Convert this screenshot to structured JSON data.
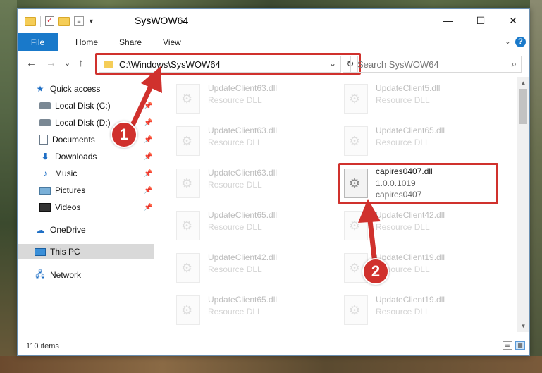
{
  "window": {
    "title": "SysWOW64",
    "controls": {
      "minimize": "—",
      "maximize": "☐",
      "close": "✕"
    }
  },
  "ribbon": {
    "tabs": [
      "File",
      "Home",
      "Share",
      "View"
    ],
    "expand_icon": "chevron-down",
    "help_label": "?"
  },
  "navigation": {
    "back_icon": "←",
    "forward_icon": "→",
    "recent_icon": "⌄",
    "up_icon": "↑",
    "address_path": "C:\\Windows\\SysWOW64",
    "search_placeholder": "Search SysWOW64"
  },
  "sidebar": {
    "items": [
      {
        "label": "Quick access",
        "icon": "star-icon",
        "pinned": false
      },
      {
        "label": "Local Disk (C:)",
        "icon": "drive-icon",
        "pinned": true
      },
      {
        "label": "Local Disk (D:)",
        "icon": "drive-icon",
        "pinned": true
      },
      {
        "label": "Documents",
        "icon": "documents-icon",
        "pinned": true
      },
      {
        "label": "Downloads",
        "icon": "download-icon",
        "pinned": true
      },
      {
        "label": "Music",
        "icon": "music-icon",
        "pinned": true
      },
      {
        "label": "Pictures",
        "icon": "pictures-icon",
        "pinned": true
      },
      {
        "label": "Videos",
        "icon": "videos-icon",
        "pinned": true
      },
      {
        "label": "OneDrive",
        "icon": "cloud-icon",
        "pinned": false
      },
      {
        "label": "This PC",
        "icon": "computer-icon",
        "pinned": false,
        "selected": true
      },
      {
        "label": "Network",
        "icon": "network-icon",
        "pinned": false
      }
    ]
  },
  "files": [
    {
      "name": "UpdateClient63.dll",
      "sub": "Resource DLL",
      "faded": true
    },
    {
      "name": "UpdateClient5.dll",
      "sub": "Resource DLL",
      "faded": true
    },
    {
      "name": "UpdateClient63.dll",
      "sub": "Resource DLL",
      "faded": true
    },
    {
      "name": "UpdateClient65.dll",
      "sub": "Resource DLL",
      "faded": true
    },
    {
      "name": "UpdateClient63.dll",
      "sub": "Resource DLL",
      "faded": true
    },
    {
      "name": "capires0407.dll",
      "sub": "1.0.0.1019",
      "sub2": "capires0407",
      "faded": false,
      "highlighted": true
    },
    {
      "name": "UpdateClient65.dll",
      "sub": "Resource DLL",
      "faded": true
    },
    {
      "name": "UpdateClient42.dll",
      "sub": "Resource DLL",
      "faded": true
    },
    {
      "name": "UpdateClient42.dll",
      "sub": "Resource DLL",
      "faded": true
    },
    {
      "name": "UpdateClient19.dll",
      "sub": "Resource DLL",
      "faded": true
    },
    {
      "name": "UpdateClient65.dll",
      "sub": "Resource DLL",
      "faded": true
    },
    {
      "name": "UpdateClient19.dll",
      "sub": "Resource DLL",
      "faded": true
    }
  ],
  "status": {
    "item_count": "110 items"
  },
  "annotations": {
    "badge1": "1",
    "badge2": "2",
    "color": "#d0312d"
  }
}
